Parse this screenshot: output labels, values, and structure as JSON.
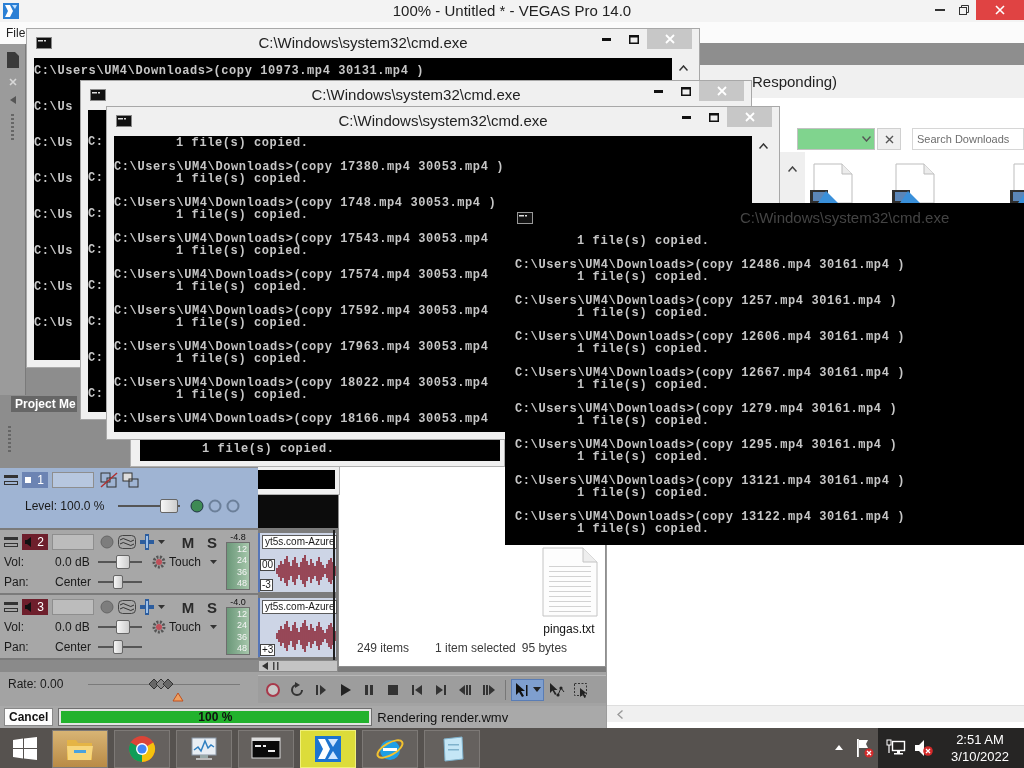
{
  "vegas": {
    "title": "100% - Untitled * - VEGAS Pro 14.0",
    "menu": [
      "File"
    ],
    "dock_tab": "Project Me",
    "tracks": [
      {
        "kind": "video",
        "number": "1",
        "selected": true,
        "level_label": "Level: 100.0 %",
        "level": 0.95
      },
      {
        "kind": "audio",
        "number": "2",
        "selected": false,
        "mute": "M",
        "solo": "S",
        "peak": "-4.8",
        "meter_marks": [
          "12",
          "24",
          "36",
          "48"
        ],
        "volume": {
          "label": "Vol:",
          "value": "0.0 dB",
          "level": 0.6
        },
        "automation": "Touch",
        "pan": {
          "label": "Pan:",
          "value": "Center",
          "level": 0.45
        },
        "clip": {
          "name": "yt5s.com-Azure",
          "tags": [
            "00",
            "-3"
          ]
        }
      },
      {
        "kind": "audio",
        "number": "3",
        "selected": false,
        "mute": "M",
        "solo": "S",
        "peak": "-4.0",
        "meter_marks": [
          "12",
          "24",
          "36",
          "48"
        ],
        "volume": {
          "label": "Vol:",
          "value": "0.0 dB",
          "level": 0.6
        },
        "automation": "Touch",
        "pan": {
          "label": "Pan:",
          "value": "Center",
          "level": 0.45
        },
        "clip": {
          "name": "yt5s.com-Azure",
          "tags": [
            "+3"
          ]
        }
      }
    ],
    "rate": {
      "label": "Rate: 0.00",
      "level": 0.48
    },
    "transport": [
      {
        "kind": "record"
      },
      {
        "kind": "loop"
      },
      {
        "kind": "playstart"
      },
      {
        "kind": "play"
      },
      {
        "kind": "pause"
      },
      {
        "kind": "stop"
      },
      {
        "kind": "gostart"
      },
      {
        "kind": "goend"
      },
      {
        "kind": "prevframe"
      },
      {
        "kind": "nextframe"
      }
    ],
    "tools": [
      {
        "kind": "edit",
        "selected": true,
        "dropdown": true
      },
      {
        "kind": "envelope",
        "selected": false,
        "dropdown": false
      },
      {
        "kind": "selection",
        "selected": false,
        "dropdown": false
      }
    ],
    "render": {
      "cancel": "Cancel",
      "percent": "100 %",
      "level": 1,
      "status": "Rendering render.wmv"
    }
  },
  "explorer": {
    "title": "Responding)",
    "address_bar": {
      "loading": true
    },
    "search": {
      "placeholder": "Search Downloads"
    },
    "files": [
      {
        "kind": "video"
      },
      {
        "kind": "video"
      },
      {
        "kind": "video"
      }
    ]
  },
  "explorer_small": {
    "files": [
      {
        "kind": "text",
        "name": "pingas.txt"
      }
    ],
    "status": {
      "count": "249 items",
      "selection": "1 item selected",
      "size": "95 bytes"
    }
  },
  "cmd_windows": [
    {
      "kind": "framed",
      "title": "C:\\Windows\\system32\\cmd.exe",
      "scrollbar": true,
      "entries": [
        {
          "command": "C:\\Users\\UM4\\Downloads>(copy 10973.mp4 30131.mp4 )"
        },
        {
          "command": "C:\\Us"
        },
        {
          "command": "C:\\Us"
        },
        {
          "command": "C:\\Us"
        },
        {
          "command": "C:\\Us"
        },
        {
          "command": "C:\\Us"
        },
        {
          "command": "C:\\Us"
        },
        {
          "command": "C:\\Us"
        }
      ]
    },
    {
      "kind": "framed",
      "title": "C:\\Windows\\system32\\cmd.exe",
      "scrollbar": false,
      "entries": [
        {
          "command": "C:"
        },
        {
          "command": "C:"
        },
        {
          "command": "C:"
        },
        {
          "command": "C:"
        },
        {
          "command": "C:"
        },
        {
          "command": "C:"
        },
        {
          "command": "C:"
        },
        {
          "command": "C:"
        }
      ]
    },
    {
      "kind": "framed",
      "title": "C:\\Windows\\system32\\cmd.exe",
      "scrollbar": true,
      "entries": [
        {
          "output": "1 file(s) copied."
        },
        {
          "command": "C:\\Users\\UM4\\Downloads>(copy 17380.mp4 30053.mp4 )",
          "output": "1 file(s) copied."
        },
        {
          "command": "C:\\Users\\UM4\\Downloads>(copy 1748.mp4 30053.mp4 )",
          "output": "1 file(s) copied."
        },
        {
          "command": "C:\\Users\\UM4\\Downloads>(copy 17543.mp4 30053.mp4",
          "output": "1 file(s) copied."
        },
        {
          "command": "C:\\Users\\UM4\\Downloads>(copy 17574.mp4 30053.mp4",
          "output": "1 file(s) copied."
        },
        {
          "command": "C:\\Users\\UM4\\Downloads>(copy 17592.mp4 30053.mp4",
          "output": "1 file(s) copied."
        },
        {
          "command": "C:\\Users\\UM4\\Downloads>(copy 17963.mp4 30053.mp4",
          "output": "1 file(s) copied."
        },
        {
          "command": "C:\\Users\\UM4\\Downloads>(copy 18022.mp4 30053.mp4",
          "output": "1 file(s) copied."
        },
        {
          "command": "C:\\Users\\UM4\\Downloads>(copy 18166.mp4 30053.mp4"
        }
      ]
    },
    {
      "kind": "dark",
      "title": "C:\\Windows\\system32\\cmd.exe",
      "entries": [
        {
          "output": "1 file(s) copied."
        },
        {
          "command": "C:\\Users\\UM4\\Downloads>(copy 12486.mp4 30161.mp4 )",
          "output": "1 file(s) copied."
        },
        {
          "command": "C:\\Users\\UM4\\Downloads>(copy 1257.mp4 30161.mp4 )",
          "output": "1 file(s) copied."
        },
        {
          "command": "C:\\Users\\UM4\\Downloads>(copy 12606.mp4 30161.mp4 )",
          "output": "1 file(s) copied."
        },
        {
          "command": "C:\\Users\\UM4\\Downloads>(copy 12667.mp4 30161.mp4 )",
          "output": "1 file(s) copied."
        },
        {
          "command": "C:\\Users\\UM4\\Downloads>(copy 1279.mp4 30161.mp4 )",
          "output": "1 file(s) copied."
        },
        {
          "command": "C:\\Users\\UM4\\Downloads>(copy 1295.mp4 30161.mp4 )",
          "output": "1 file(s) copied."
        },
        {
          "command": "C:\\Users\\UM4\\Downloads>(copy 13121.mp4 30161.mp4 )",
          "output": "1 file(s) copied."
        },
        {
          "command": "C:\\Users\\UM4\\Downloads>(copy 13122.mp4 30161.mp4 )",
          "output": "1 file(s) copied."
        }
      ]
    },
    {
      "kind": "bare",
      "entries": [
        {
          "output": "1 file(s) copied."
        }
      ]
    },
    {
      "kind": "bare"
    }
  ],
  "taskbar": {
    "apps": [
      {
        "kind": "explorer",
        "flashing": true,
        "highlighted": false
      },
      {
        "kind": "chrome",
        "flashing": false,
        "highlighted": false
      },
      {
        "kind": "monitor",
        "flashing": false,
        "highlighted": false
      },
      {
        "kind": "console",
        "flashing": false,
        "highlighted": false
      },
      {
        "kind": "vegas",
        "flashing": false,
        "highlighted": true
      },
      {
        "kind": "ie",
        "flashing": false,
        "highlighted": false
      },
      {
        "kind": "notepad",
        "flashing": false,
        "highlighted": false
      }
    ],
    "tray": [
      {
        "kind": "overflow",
        "alert": false
      },
      {
        "kind": "flag",
        "alert": true
      },
      {
        "kind": "network",
        "alert": false
      },
      {
        "kind": "speaker",
        "alert": true
      }
    ],
    "clock": {
      "time": "2:51 AM",
      "date": "3/10/2022"
    }
  }
}
